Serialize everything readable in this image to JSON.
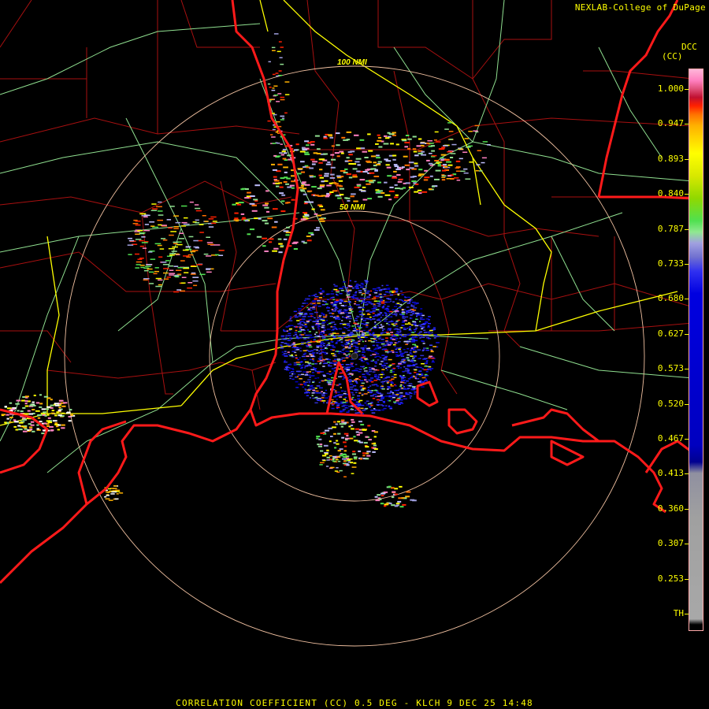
{
  "credit": "NEXLAB-College of DuPage",
  "product_code": "DCC",
  "unit_label": "(CC)",
  "range_rings": [
    "100 NMI",
    "50 NMI"
  ],
  "footer": "CORRELATION COEFFICIENT (CC) 0.5 DEG - KLCH 9 DEC 25 14:48",
  "colorbar": {
    "labels": [
      "1.000",
      "0.947",
      "0.893",
      "0.840",
      "0.787",
      "0.733",
      "0.680",
      "0.627",
      "0.573",
      "0.520",
      "0.467",
      "0.413",
      "0.360",
      "0.307",
      "0.253",
      "TH"
    ],
    "colors": [
      "#ffb6d9",
      "#ff80c0",
      "#e0507a",
      "#c01030",
      "#ff2000",
      "#ff7000",
      "#ffb000",
      "#ffff00",
      "#d8e800",
      "#90d800",
      "#50e050",
      "#90e890",
      "#a0a0e0",
      "#7070d0",
      "#3030f0",
      "#0000e0",
      "#0000c0",
      "#000090",
      "#9090a0",
      "#a0a0a0",
      "#a8a8a8",
      "#000000"
    ],
    "stops": [
      0.0,
      0.02,
      0.035,
      0.05,
      0.065,
      0.08,
      0.1,
      0.15,
      0.19,
      0.23,
      0.27,
      0.29,
      0.31,
      0.335,
      0.36,
      0.4,
      0.67,
      0.7,
      0.72,
      0.8,
      0.98,
      0.99
    ]
  },
  "colors": {
    "coast": "#ff2020",
    "county": "#b01010",
    "road": "#a0e8a0",
    "interstate": "#ffff00",
    "ring": "#ffc8a0",
    "text": "#ffff00"
  }
}
